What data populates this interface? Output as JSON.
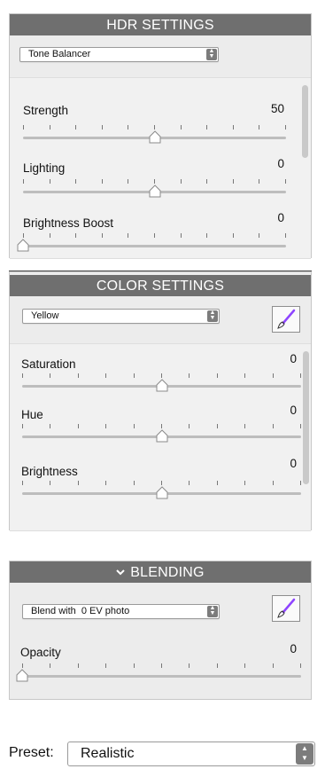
{
  "hdr": {
    "title": "HDR SETTINGS",
    "mode": "Tone Balancer",
    "sliders": [
      {
        "label": "Strength",
        "value": "50",
        "level": 0.5
      },
      {
        "label": "Lighting",
        "value": "0",
        "level": 0.5
      },
      {
        "label": "Brightness Boost",
        "value": "0",
        "level": 0.0
      }
    ]
  },
  "color": {
    "title": "COLOR SETTINGS",
    "channel": "Yellow",
    "sliders": [
      {
        "label": "Saturation",
        "value": "0",
        "level": 0.5
      },
      {
        "label": "Hue",
        "value": "0",
        "level": 0.5
      },
      {
        "label": "Brightness",
        "value": "0",
        "level": 0.5
      }
    ]
  },
  "blending": {
    "title": "BLENDING",
    "mode": "Blend with  0 EV photo",
    "sliders": [
      {
        "label": "Opacity",
        "value": "0",
        "level": 0.0
      }
    ]
  },
  "preset": {
    "label": "Preset:",
    "value": "Realistic"
  },
  "icons": [
    "chevron-down-icon",
    "paintbrush-icon",
    "select-stepper-icon"
  ],
  "colors": {
    "header": "#6f6f6f",
    "panel": "#ececec",
    "brush": "#8e44ff"
  }
}
